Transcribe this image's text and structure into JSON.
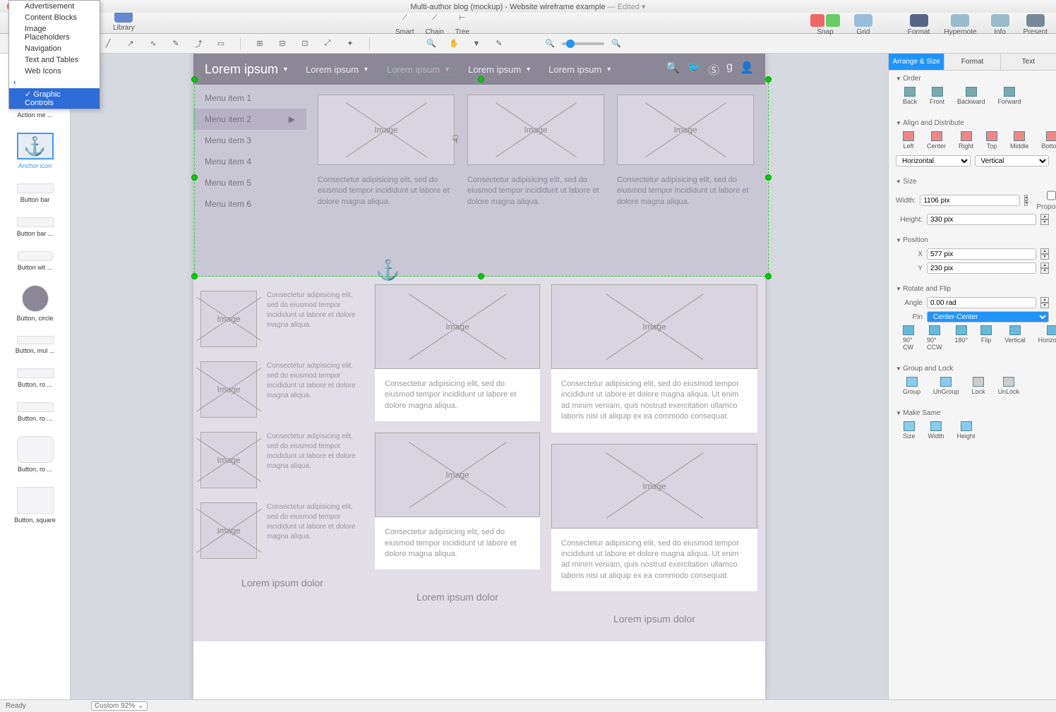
{
  "title": "Multi-author blog (mockup) - Website wireframe example",
  "edited": "— Edited ▾",
  "toolbar": {
    "library": "Library",
    "smart": "Smart",
    "chain": "Chain",
    "tree": "Tree",
    "snap": "Snap",
    "grid": "Grid",
    "format": "Format",
    "hypernote": "Hypernote",
    "info": "Info",
    "present": "Present"
  },
  "dropdown": {
    "items": [
      "Advertisement",
      "Content Blocks",
      "Image Placeholders",
      "Navigation",
      "Text and Tables",
      "Web Icons",
      "Graphic Controls"
    ],
    "selected": "Graphic Controls"
  },
  "library": {
    "items": [
      {
        "label": "Action me ..."
      },
      {
        "label": "Anchor icon",
        "selected": true
      },
      {
        "label": "Button bar"
      },
      {
        "label": "Button bar ..."
      },
      {
        "label": "Button wit ..."
      },
      {
        "label": "Button, circle"
      },
      {
        "label": "Button, mul ..."
      },
      {
        "label": "Button, ro ..."
      },
      {
        "label": "Button, ro ..."
      },
      {
        "label": "Button, ro ..."
      },
      {
        "label": "Button, square"
      }
    ]
  },
  "wireframe": {
    "nav": [
      "Lorem ipsum",
      "Lorem ipsum",
      "Lorem ipsum",
      "Lorem ipsum",
      "Lorem ipsum"
    ],
    "menu": [
      "Menu item 1",
      "Menu item 2",
      "Menu item 3",
      "Menu item 4",
      "Menu item 5",
      "Menu item 6"
    ],
    "image_label": "Image",
    "card_text": "Consectetur adipisicing elit, sed do eiusmod tempor incididunt ut labore et dolore magna aliqua.",
    "small_text": "Consectetur adipisicing elit, sed do eiusmod tempor incididunt ut labore et dolore magna aliqua.",
    "mid_text": "Consectetur adipisicing elit, sed do eiusmod tempor incididunt ut labore et dolore magna aliqua.",
    "right_text": "Consectetur adipisicing elit, sed do eiusmod tempor incididunt ut labore et dolore magna aliqua. Ut enim ad minim veniam, quis nostrud exercitation ullamco laboris nisi ut aliquip ex ea commodo consequat.",
    "col_title": "Lorem ipsum dolor"
  },
  "inspector": {
    "tabs": [
      "Arrange & Size",
      "Format",
      "Text"
    ],
    "order": {
      "title": "Order",
      "labels": [
        "Back",
        "Front",
        "Backward",
        "Forward"
      ]
    },
    "align": {
      "title": "Align and Distribute",
      "labels": [
        "Left",
        "Center",
        "Right",
        "Top",
        "Middle",
        "Bottom"
      ],
      "h": "Horizontal",
      "v": "Vertical"
    },
    "size": {
      "title": "Size",
      "width_label": "Width:",
      "width": "1106 pix",
      "height_label": "Height:",
      "height": "330 pix",
      "lock": "Lock Proportions"
    },
    "position": {
      "title": "Position",
      "x_label": "X",
      "x": "577 pix",
      "y_label": "Y",
      "y": "230 pix"
    },
    "rotate": {
      "title": "Rotate and Flip",
      "angle_label": "Angle",
      "angle": "0.00 rad",
      "pin_label": "Pin",
      "pin": "Center-Center",
      "labels": [
        "90° CW",
        "90° CCW",
        "180°",
        "Flip",
        "Vertical",
        "Horizontal"
      ]
    },
    "group": {
      "title": "Group and Lock",
      "labels": [
        "Group",
        "UnGroup",
        "Lock",
        "UnLock"
      ]
    },
    "same": {
      "title": "Make Same",
      "labels": [
        "Size",
        "Width",
        "Height"
      ]
    }
  },
  "status": {
    "ready": "Ready",
    "zoom": "Custom 92%"
  }
}
